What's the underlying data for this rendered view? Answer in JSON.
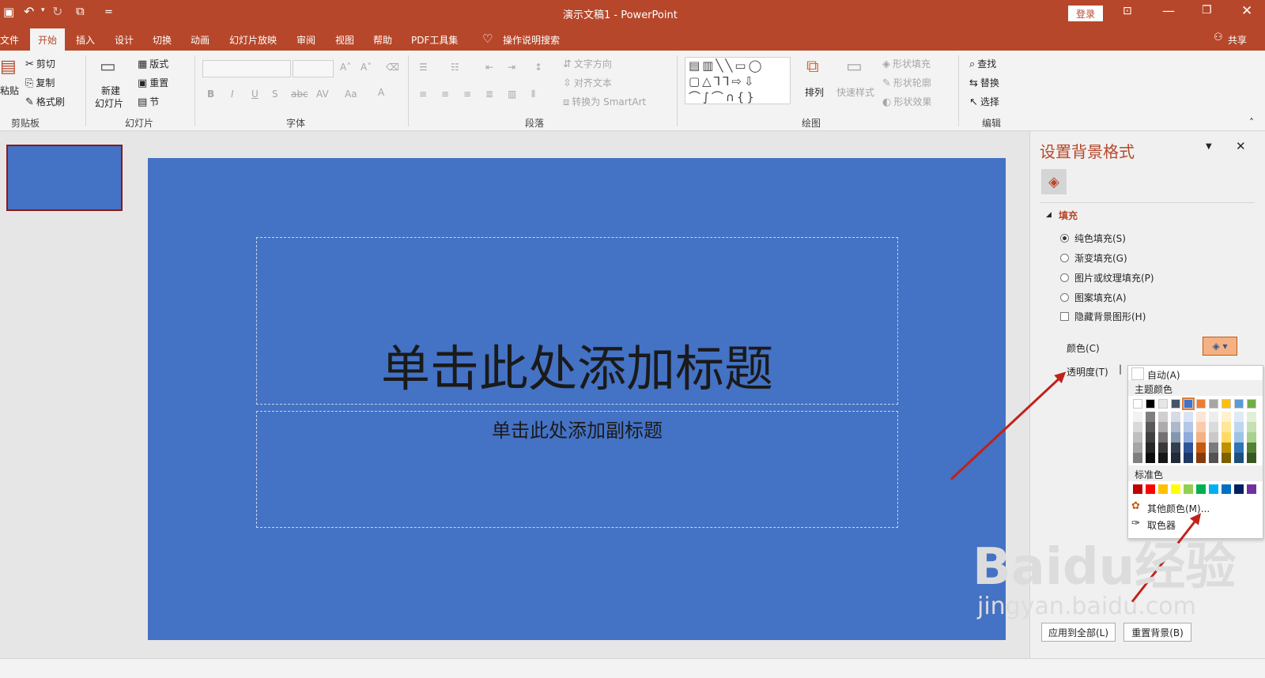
{
  "window": {
    "title": "演示文稿1  -  PowerPoint",
    "login_label": "登录",
    "quick_access_more": "="
  },
  "tabs": [
    {
      "label": "文件"
    },
    {
      "label": "开始"
    },
    {
      "label": "插入"
    },
    {
      "label": "设计"
    },
    {
      "label": "切换"
    },
    {
      "label": "动画"
    },
    {
      "label": "幻灯片放映"
    },
    {
      "label": "审阅"
    },
    {
      "label": "视图"
    },
    {
      "label": "帮助"
    },
    {
      "label": "PDF工具集"
    },
    {
      "label": "操作说明搜索"
    }
  ],
  "share_label": "共享",
  "ribbon": {
    "clipboard": {
      "paste": "粘贴",
      "cut": "剪切",
      "copy": "复制",
      "format_painter": "格式刷",
      "group": "剪贴板"
    },
    "slides": {
      "new_slide": "新建",
      "new_slide2": "幻灯片",
      "layout": "版式",
      "reset": "重置",
      "section": "节",
      "group": "幻灯片"
    },
    "font": {
      "group": "字体"
    },
    "paragraph": {
      "text_direction": "文字方向",
      "align_text": "对齐文本",
      "convert_smartart": "转换为 SmartArt",
      "group": "段落"
    },
    "drawing": {
      "arrange": "排列",
      "quick_styles": "快速样式",
      "shape_fill": "形状填充",
      "shape_outline": "形状轮廓",
      "shape_effects": "形状效果",
      "group": "绘图"
    },
    "editing": {
      "find": "查找",
      "replace": "替换",
      "select": "选择",
      "group": "编辑"
    }
  },
  "slide": {
    "title_placeholder": "单击此处添加标题",
    "subtitle_placeholder": "单击此处添加副标题",
    "background_color": "#4472c4"
  },
  "pane": {
    "title": "设置背景格式",
    "section": "填充",
    "options": [
      {
        "label": "纯色填充(S)",
        "checked": true
      },
      {
        "label": "渐变填充(G)",
        "checked": false
      },
      {
        "label": "图片或纹理填充(P)",
        "checked": false
      },
      {
        "label": "图案填充(A)",
        "checked": false
      }
    ],
    "hide_bg_graphics": "隐藏背景图形(H)",
    "color_label": "颜色(C)",
    "transparency_label": "透明度(T)",
    "apply_all": "应用到全部(L)",
    "reset_bg": "重置背景(B)"
  },
  "palette": {
    "auto": "自动(A)",
    "theme_colors_label": "主题颜色",
    "standard_colors_label": "标准色",
    "more_colors": "其他颜色(M)...",
    "eyedropper": "取色器",
    "theme_top": [
      "#ffffff",
      "#000000",
      "#e7e6e6",
      "#44546a",
      "#4472c4",
      "#ed7d31",
      "#a5a5a5",
      "#ffc000",
      "#5b9bd5",
      "#70ad47"
    ],
    "theme_shades": [
      [
        "#f2f2f2",
        "#7f7f7f",
        "#d0cece",
        "#d6dce5",
        "#dae3f3",
        "#fbe5d6",
        "#ededed",
        "#fff2cc",
        "#deebf7",
        "#e2f0d9"
      ],
      [
        "#d9d9d9",
        "#595959",
        "#aeabab",
        "#adb9ca",
        "#b4c7e7",
        "#f8cbad",
        "#dbdbdb",
        "#ffe699",
        "#bdd7ee",
        "#c5e0b4"
      ],
      [
        "#bfbfbf",
        "#404040",
        "#757171",
        "#8497b0",
        "#8faadc",
        "#f4b183",
        "#c9c9c9",
        "#ffd966",
        "#9dc3e6",
        "#a9d18e"
      ],
      [
        "#a6a6a6",
        "#262626",
        "#3a3838",
        "#333f50",
        "#2f5597",
        "#c55a11",
        "#7b7b7b",
        "#bf9000",
        "#2e75b6",
        "#548235"
      ],
      [
        "#7f7f7f",
        "#0d0d0d",
        "#171616",
        "#222a35",
        "#203864",
        "#843c0c",
        "#525252",
        "#7f6000",
        "#1f4e79",
        "#385723"
      ]
    ],
    "standard": [
      "#c00000",
      "#ff0000",
      "#ffc000",
      "#ffff00",
      "#92d050",
      "#00b050",
      "#00b0f0",
      "#0070c0",
      "#002060",
      "#7030a0"
    ]
  },
  "watermark": {
    "brand": "Baidu经验",
    "url": "jingyan.baidu.com"
  }
}
